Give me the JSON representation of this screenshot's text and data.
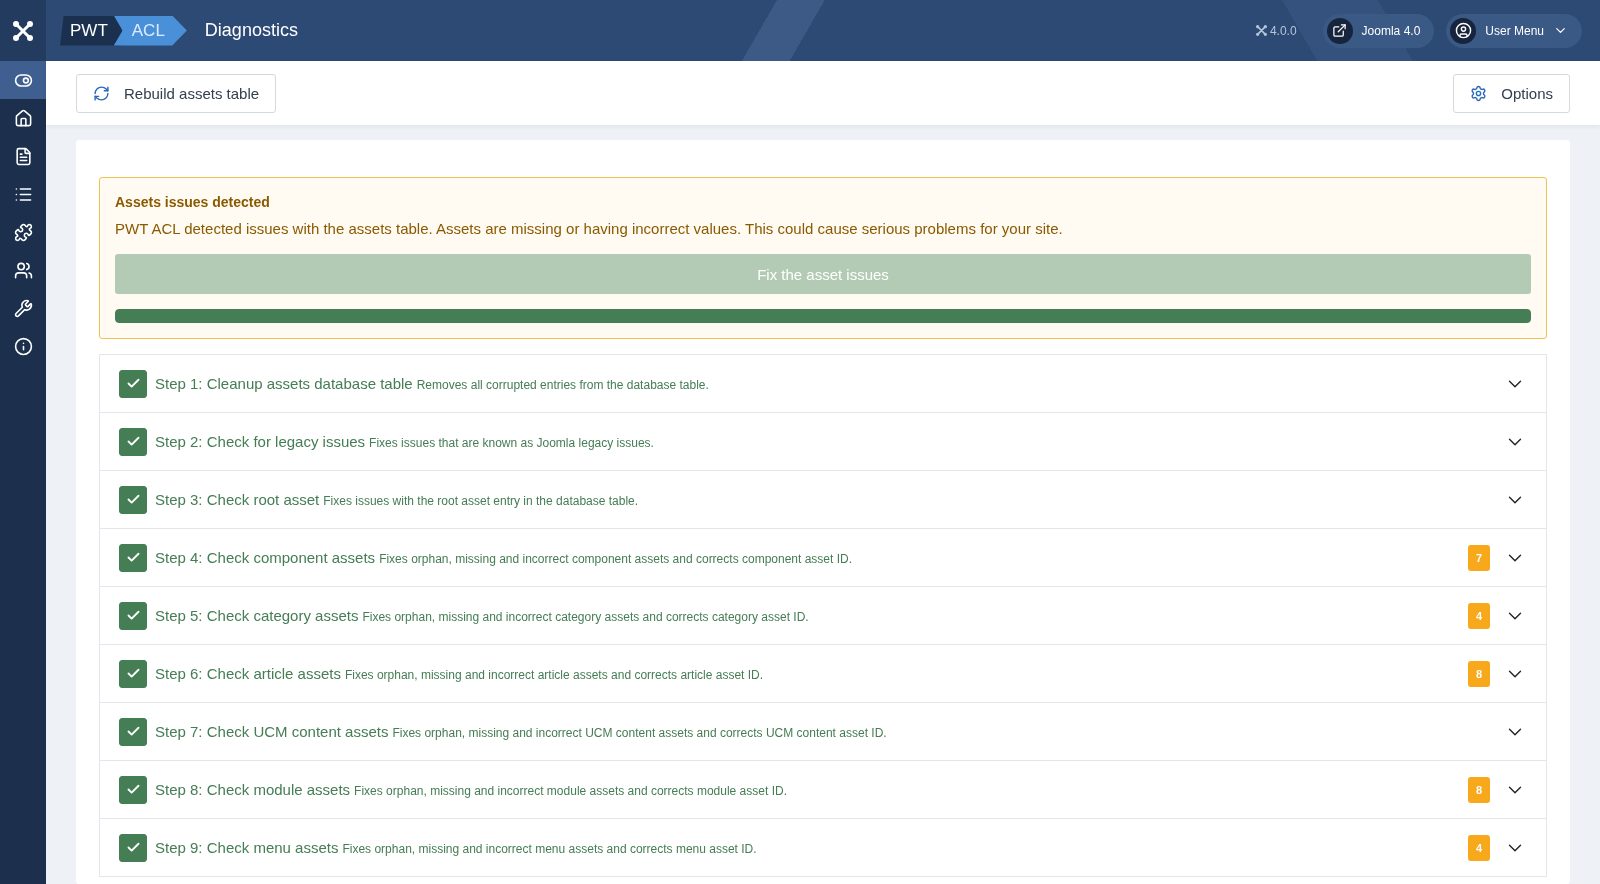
{
  "header": {
    "logo": {
      "left": "PWT",
      "right": "ACL"
    },
    "title": "Diagnostics",
    "version": "4.0.0",
    "site_link": "Joomla 4.0",
    "user_menu": "User Menu"
  },
  "sidebar": {
    "items": [
      {
        "kind": "toggle",
        "selected": true
      },
      {
        "kind": "home",
        "selected": false
      },
      {
        "kind": "file",
        "selected": false
      },
      {
        "kind": "list",
        "selected": false
      },
      {
        "kind": "puzzle",
        "selected": false
      },
      {
        "kind": "users",
        "selected": false
      },
      {
        "kind": "wrench",
        "selected": false
      },
      {
        "kind": "info",
        "selected": false
      }
    ]
  },
  "toolbar": {
    "rebuild": "Rebuild assets table",
    "options": "Options"
  },
  "alert": {
    "title": "Assets issues detected",
    "message": "PWT ACL detected issues with the assets table. Assets are missing or having incorrect values. This could cause serious problems for your site.",
    "fix_button": "Fix the asset issues",
    "fix_disabled": true,
    "progress": {
      "level": 1
    }
  },
  "steps": [
    {
      "title": "Step 1: Cleanup assets database table",
      "description": "Removes all corrupted entries from the database table.",
      "checked": true,
      "expanded": false
    },
    {
      "title": "Step 2: Check for legacy issues",
      "description": "Fixes issues that are known as Joomla legacy issues.",
      "checked": true,
      "expanded": false
    },
    {
      "title": "Step 3: Check root asset",
      "description": "Fixes issues with the root asset entry in the database table.",
      "checked": true,
      "expanded": false
    },
    {
      "title": "Step 4: Check component assets",
      "description": "Fixes orphan, missing and incorrect component assets and corrects component asset ID.",
      "checked": true,
      "expanded": false,
      "badge": "7"
    },
    {
      "title": "Step 5: Check category assets",
      "description": "Fixes orphan, missing and incorrect category assets and corrects category asset ID.",
      "checked": true,
      "expanded": false,
      "badge": "4"
    },
    {
      "title": "Step 6: Check article assets",
      "description": "Fixes orphan, missing and incorrect article assets and corrects article asset ID.",
      "checked": true,
      "expanded": false,
      "badge": "8"
    },
    {
      "title": "Step 7: Check UCM content assets",
      "description": "Fixes orphan, missing and incorrect UCM content assets and corrects UCM content asset ID.",
      "checked": true,
      "expanded": false
    },
    {
      "title": "Step 8: Check module assets",
      "description": "Fixes orphan, missing and incorrect module assets and corrects module asset ID.",
      "checked": true,
      "expanded": false,
      "badge": "8"
    },
    {
      "title": "Step 9: Check menu assets",
      "description": "Fixes orphan, missing and incorrect menu assets and corrects menu asset ID.",
      "checked": true,
      "expanded": false,
      "badge": "4"
    }
  ]
}
